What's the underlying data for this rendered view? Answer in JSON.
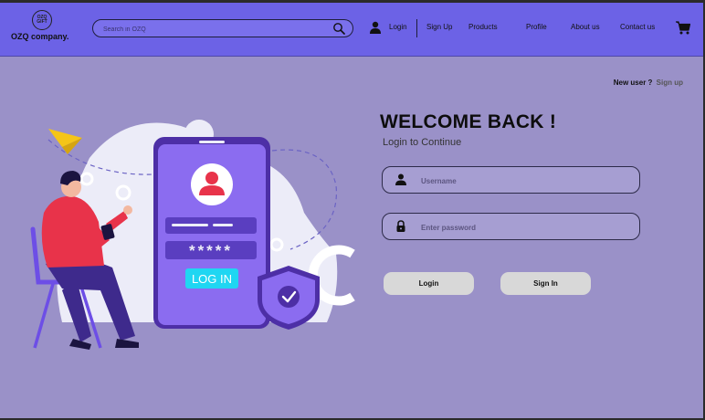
{
  "header": {
    "logo_mark": "OZQ GIFT",
    "logo_text": "OZQ company.",
    "search_placeholder": "Search in OZQ",
    "nav": {
      "login": "Login",
      "signup": "Sign Up",
      "products": "Products",
      "profile": "Profile",
      "about": "About us",
      "contact": "Contact us"
    }
  },
  "main": {
    "new_user_prompt": "New user ?",
    "new_user_link": "Sign up",
    "title": "WELCOME BACK !",
    "subtitle": "Login to Continue",
    "username_placeholder": "Username",
    "password_placeholder": "Enter password",
    "login_button": "Login",
    "signin_button": "Sign In"
  },
  "illustration": {
    "phone_password_mask": "*****",
    "phone_login_label": "LOG IN"
  },
  "colors": {
    "header": "#6c62e6",
    "background": "#9a91c8",
    "phone": "#8b6cf0",
    "login_button": "#1fd6f2",
    "accent_red": "#e8334a"
  }
}
